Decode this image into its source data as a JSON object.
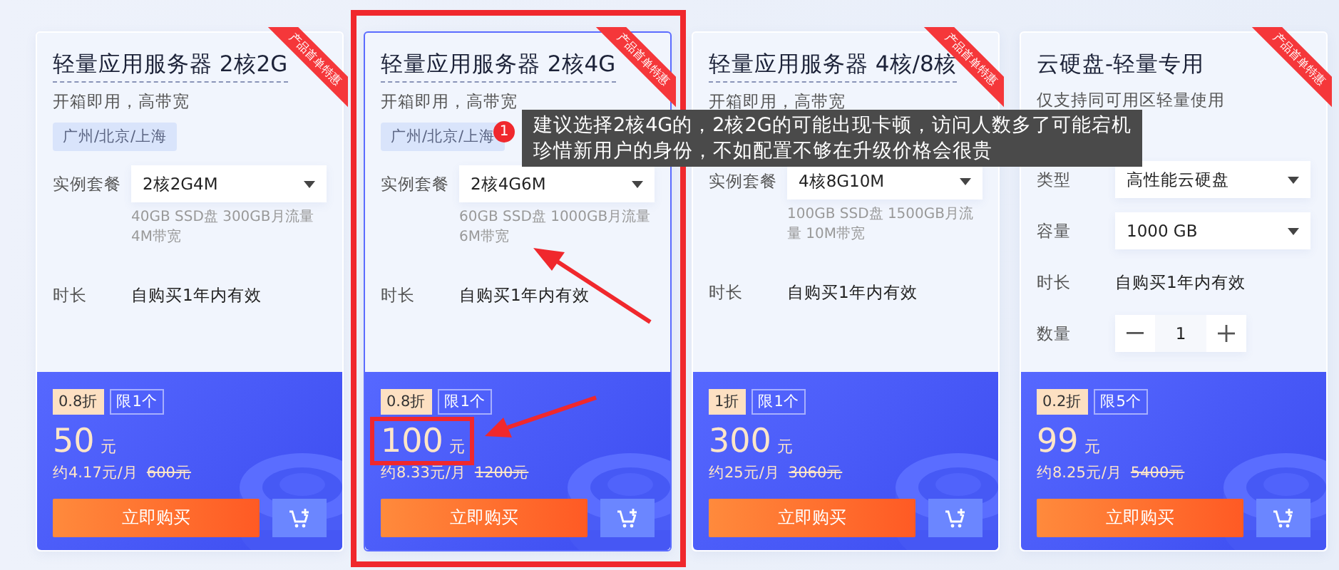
{
  "cards": [
    {
      "title": "轻量应用服务器 2核2G",
      "underlined": true,
      "subtitle": "开箱即用，高带宽",
      "region": "广州/北京/上海",
      "ribbon": "产品首单特惠",
      "selected": false,
      "fields": [
        {
          "kind": "select",
          "label": "实例套餐",
          "value": "2核2G4M",
          "note": "40GB SSD盘 300GB月流量 4M带宽"
        },
        {
          "kind": "text",
          "label": "时长",
          "value": "自购买1年内有效"
        }
      ],
      "discount": "0.8折",
      "limit": "限1个",
      "price": "50",
      "unit": "元",
      "monthly": "约4.17元/月",
      "original": "600元",
      "buy": "立即购买"
    },
    {
      "title": "轻量应用服务器 2核4G",
      "underlined": true,
      "subtitle": "开箱即用，高带宽",
      "region": "广州/北京/上海",
      "ribbon": "产品首单特惠",
      "selected": true,
      "fields": [
        {
          "kind": "select",
          "label": "实例套餐",
          "value": "2核4G6M",
          "note": "60GB SSD盘 1000GB月流量 6M带宽"
        },
        {
          "kind": "text",
          "label": "时长",
          "value": "自购买1年内有效"
        }
      ],
      "discount": "0.8折",
      "limit": "限1个",
      "price": "100",
      "unit": "元",
      "monthly": "约8.33元/月",
      "original": "1200元",
      "buy": "立即购买"
    },
    {
      "title": "轻量应用服务器 4核/8核",
      "underlined": true,
      "subtitle": "开箱即用，高带宽",
      "ribbon": "产品首单特惠",
      "selected": false,
      "fields": [
        {
          "kind": "select",
          "label": "实例套餐",
          "value": "4核8G10M",
          "note": "100GB SSD盘 1500GB月流量 10M带宽"
        },
        {
          "kind": "text",
          "label": "时长",
          "value": "自购买1年内有效"
        }
      ],
      "discount": "1折",
      "limit": "限1个",
      "price": "300",
      "unit": "元",
      "monthly": "约25元/月",
      "original": "3060元",
      "buy": "立即购买"
    },
    {
      "title": "云硬盘-轻量专用",
      "underlined": false,
      "subtitle": "仅支持同可用区轻量使用",
      "ribbon": "产品首单特惠",
      "selected": false,
      "fields": [
        {
          "kind": "select",
          "label": "类型",
          "value": "高性能云硬盘"
        },
        {
          "kind": "select",
          "label": "容量",
          "value": "1000 GB"
        },
        {
          "kind": "text",
          "label": "时长",
          "value": "自购买1年内有效"
        },
        {
          "kind": "stepper",
          "label": "数量",
          "value": "1"
        }
      ],
      "discount": "0.2折",
      "limit": "限5个",
      "price": "99",
      "unit": "元",
      "monthly": "约8.25元/月",
      "original": "5400元",
      "buy": "立即购买"
    }
  ],
  "annotation": {
    "badge": "1",
    "lines": [
      "建议选择2核4G的，2核2G的可能出现卡顿，访问人数多了可能宕机",
      "珍惜新用户的身份，不如配置不够在升级价格会很贵"
    ]
  }
}
